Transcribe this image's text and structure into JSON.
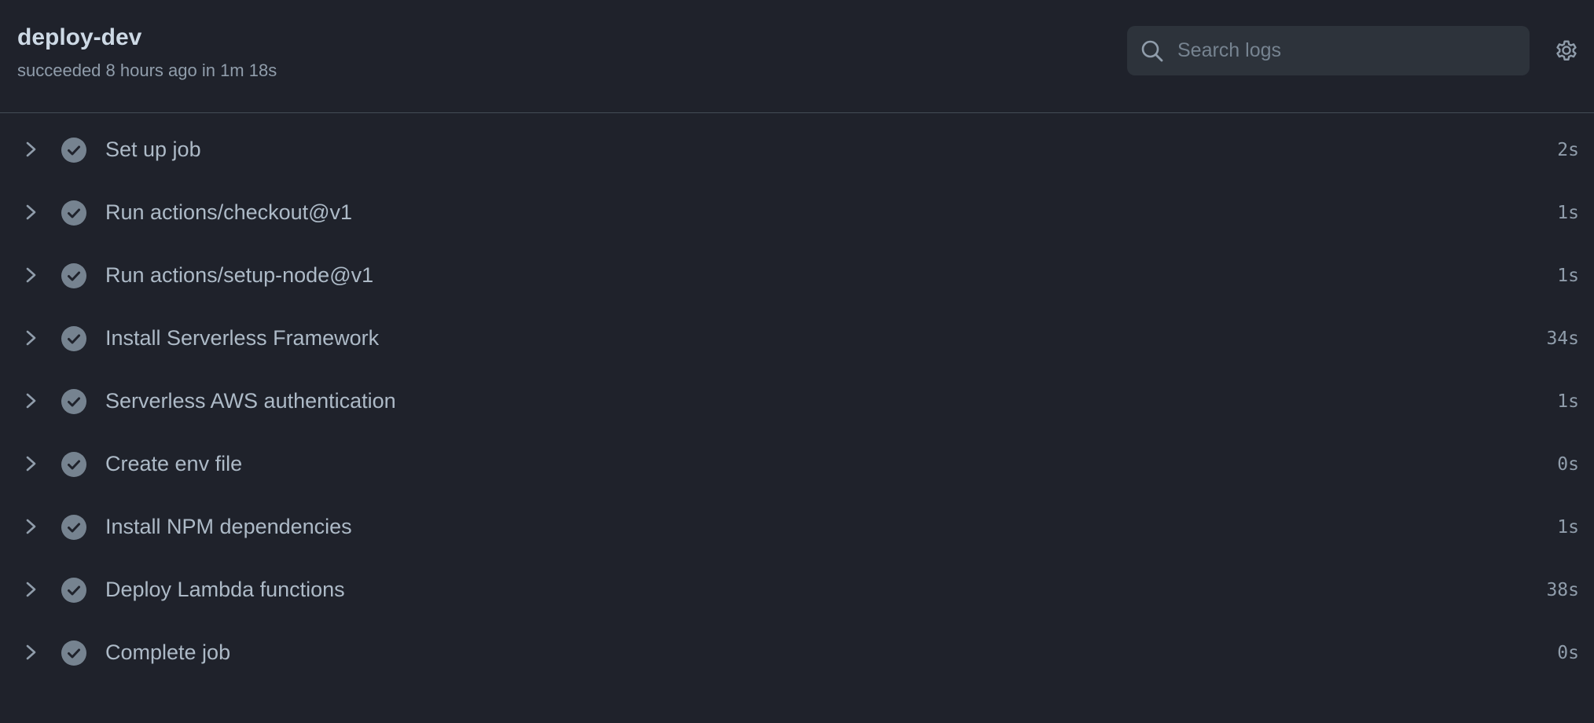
{
  "job": {
    "title": "deploy-dev",
    "subtitle": "succeeded 8 hours ago in 1m 18s"
  },
  "search": {
    "placeholder": "Search logs",
    "value": "",
    "icon": "search-icon"
  },
  "settings": {
    "icon": "gear-icon"
  },
  "colors": {
    "background": "#1f222b",
    "check_circle": "#768390",
    "text_primary": "#cdd9e5",
    "text_muted": "#909dab"
  },
  "steps": [
    {
      "label": "Set up job",
      "duration": "2s",
      "status": "success"
    },
    {
      "label": "Run actions/checkout@v1",
      "duration": "1s",
      "status": "success"
    },
    {
      "label": "Run actions/setup-node@v1",
      "duration": "1s",
      "status": "success"
    },
    {
      "label": "Install Serverless Framework",
      "duration": "34s",
      "status": "success"
    },
    {
      "label": "Serverless AWS authentication",
      "duration": "1s",
      "status": "success"
    },
    {
      "label": "Create env file",
      "duration": "0s",
      "status": "success"
    },
    {
      "label": "Install NPM dependencies",
      "duration": "1s",
      "status": "success"
    },
    {
      "label": "Deploy Lambda functions",
      "duration": "38s",
      "status": "success"
    },
    {
      "label": "Complete job",
      "duration": "0s",
      "status": "success"
    }
  ]
}
